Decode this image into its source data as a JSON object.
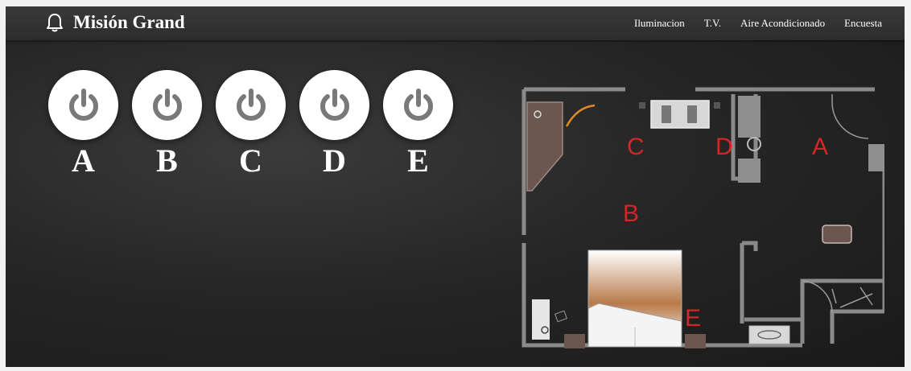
{
  "header": {
    "title": "Misión Grand",
    "icon": "bell-icon",
    "nav": [
      {
        "label": "Iluminacion"
      },
      {
        "label": "T.V."
      },
      {
        "label": "Aire Acondicionado"
      },
      {
        "label": "Encuesta"
      }
    ]
  },
  "zones": [
    {
      "label": "A",
      "icon": "power-icon"
    },
    {
      "label": "B",
      "icon": "power-icon"
    },
    {
      "label": "C",
      "icon": "power-icon"
    },
    {
      "label": "D",
      "icon": "power-icon"
    },
    {
      "label": "E",
      "icon": "power-icon"
    }
  ],
  "floorplan": {
    "labels": [
      "A",
      "B",
      "C",
      "D",
      "E"
    ]
  },
  "colors": {
    "navbar": "#333333",
    "power_icon": "#7a7a7a",
    "plan_label": "#d42626"
  }
}
